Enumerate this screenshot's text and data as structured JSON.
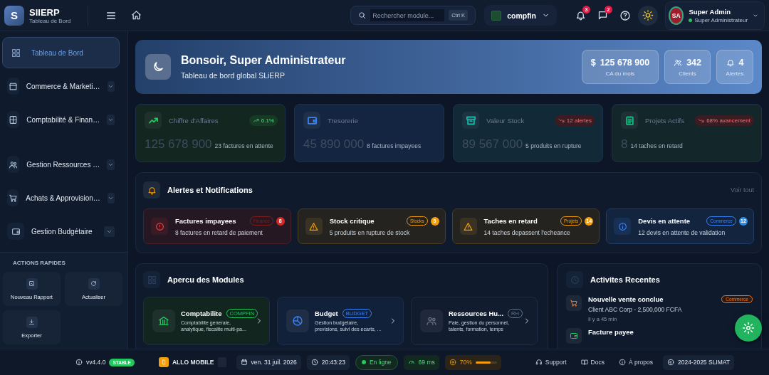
{
  "brand": {
    "logo": "S",
    "name": "SlIERP",
    "subtitle": "Tableau de Bord"
  },
  "search": {
    "placeholder": "Rechercher module...",
    "shortcut": "Ctrl K"
  },
  "company": {
    "name": "compfin"
  },
  "notifications": {
    "count": "3"
  },
  "messages": {
    "count": "2"
  },
  "user": {
    "initials": "SA",
    "name": "Super Admin",
    "role": "Super Administrateur",
    "online": true
  },
  "sidebar": {
    "items": [
      {
        "label": "Tableau de Bord",
        "selected": true,
        "expandable": false
      },
      {
        "label": "Commerce & Marketi…",
        "selected": false,
        "expandable": true
      },
      {
        "label": "Comptabilité & Finan…",
        "selected": false,
        "expandable": true
      },
      {
        "label": "Gestion Ressources …",
        "selected": false,
        "expandable": true
      },
      {
        "label": "Achats & Approvision…",
        "selected": false,
        "expandable": true
      },
      {
        "label": "Gestion Budgétaire",
        "selected": false,
        "expandable": true
      }
    ],
    "quick_actions": {
      "title": "ACTIONS RAPIDES",
      "items": [
        "Nouveau Rapport",
        "Actualiser",
        "Exporter"
      ]
    }
  },
  "hero": {
    "title": "Bonsoir, Super Administrateur",
    "subtitle": "Tableau de bord global SLiERP",
    "stats": [
      {
        "symbol": "$",
        "value": "125 678 900",
        "label": "CA du mois"
      },
      {
        "value": "342",
        "label": "Clients"
      },
      {
        "value": "4",
        "label": "Alertes"
      }
    ]
  },
  "kpis": [
    {
      "title": "Chiffre d'Affaires",
      "value": "125 678 900",
      "note": "23 factures en attente",
      "badge": "6.1%",
      "rising": true,
      "color": "#22c55e"
    },
    {
      "title": "Tresorerie",
      "value": "45 890 000",
      "note": "8 factures impayees",
      "color": "#3b82f6"
    },
    {
      "title": "Valeur Stock",
      "value": "89 567 000",
      "note": "5 produits en rupture",
      "badge": "12 alertes",
      "rising": false,
      "color": "#14b8a6"
    },
    {
      "title": "Projets Actifs",
      "value": "8",
      "note": "14 taches en retard",
      "badge": "68% avancement",
      "rising": false,
      "color": "#10b981"
    }
  ],
  "alerts": {
    "title": "Alertes et Notifications",
    "link": "Voir tout",
    "items": [
      {
        "title": "Factures impayees",
        "text": "8 factures en retard de paiement",
        "tag": "Finance",
        "count": "8",
        "kind": "error"
      },
      {
        "title": "Stock critique",
        "text": "5 produits en rupture de stock",
        "tag": "Stocks",
        "count": "5",
        "kind": "warning"
      },
      {
        "title": "Taches en retard",
        "text": "14 taches depassent l'echeance",
        "tag": "Projets",
        "count": "14",
        "kind": "warning"
      },
      {
        "title": "Devis en attente",
        "text": "12 devis en attente de validation",
        "tag": "Commerce",
        "count": "12",
        "kind": "info"
      }
    ]
  },
  "modules": {
    "title": "Apercu des Modules",
    "items": [
      {
        "name": "Comptabilite",
        "tag": "COMPFIN",
        "description": "Comptabilite generale, analytique, fiscalite multi-pa...",
        "color": "#22c55e"
      },
      {
        "name": "Budget",
        "tag": "BUDGET",
        "description": "Gestion budgetaire, previsions, suivi des ecarts, ...",
        "color": "#3b82f6"
      },
      {
        "name": "Ressources Hu...",
        "tag": "RH",
        "description": "Paie, gestion du personnel, talents, formation, temps",
        "color": "#64748b"
      }
    ]
  },
  "activities": {
    "title": "Activites Recentes",
    "items": [
      {
        "title": "Nouvelle vente conclue",
        "detail": "Client ABC Corp - 2,500,000 FCFA",
        "time": "Il y a 45 min",
        "tag": "Commerce",
        "color": "#f97316"
      },
      {
        "title": "Facture payee",
        "color": "#22c55e"
      }
    ]
  },
  "status_bar": {
    "version": "vv4.4.0",
    "channel": "STABLE",
    "app": "ALLO MOBILE",
    "date": "ven. 31 juil. 2026",
    "time": "20:43:23",
    "connection": "En ligne",
    "latency": "69 ms",
    "load": {
      "reading": "70%",
      "level": 0.7
    },
    "links": [
      "Support",
      "Docs",
      "À propos"
    ],
    "copyright": "2024-2025 SLIMAT"
  }
}
